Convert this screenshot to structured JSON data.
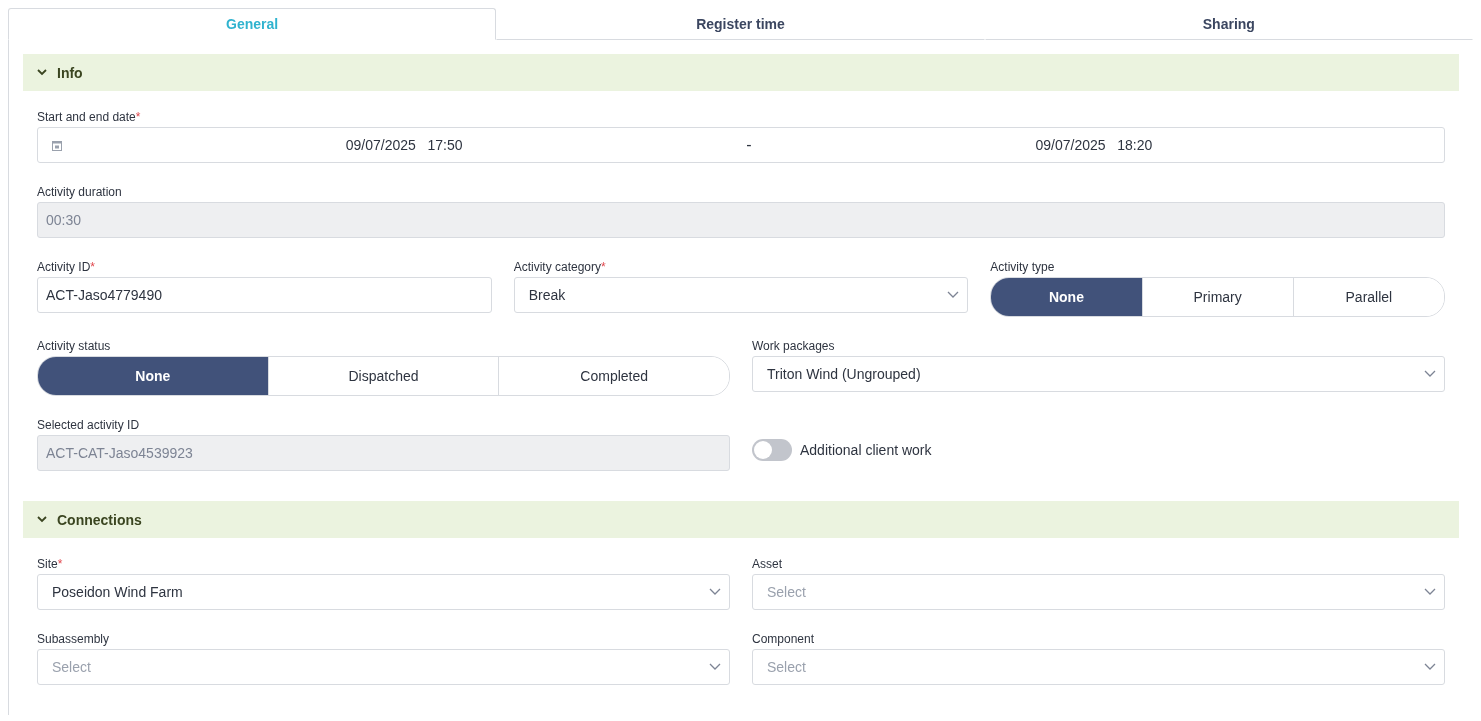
{
  "tabs": [
    {
      "label": "General",
      "selected": true
    },
    {
      "label": "Register time",
      "selected": false
    },
    {
      "label": "Sharing",
      "selected": false
    }
  ],
  "sections": [
    {
      "title": "Info",
      "expanded": true,
      "rows": [
        {
          "fields": [
            {
              "kind": "daterange",
              "label": "Start and end date",
              "marker": "*",
              "start": "09/07/2025   17:50",
              "separator": "-",
              "end": "09/07/2025   18:20"
            }
          ]
        },
        {
          "fields": [
            {
              "kind": "readonly",
              "label": "Activity duration",
              "value": "00:30"
            }
          ]
        },
        {
          "fields": [
            {
              "kind": "text",
              "label": "Activity ID",
              "marker": "*",
              "value": "ACT-Jaso4779490"
            },
            {
              "kind": "select",
              "label": "Activity category",
              "marker": "*",
              "value": "Break"
            },
            {
              "kind": "segmented",
              "label": "Activity type",
              "options": [
                {
                  "label": "None",
                  "selected": true
                },
                {
                  "label": "Primary",
                  "selected": false
                },
                {
                  "label": "Parallel",
                  "selected": false
                }
              ]
            }
          ]
        },
        {
          "fields": [
            {
              "kind": "segmented",
              "label": "Activity status",
              "options": [
                {
                  "label": "None",
                  "selected": true
                },
                {
                  "label": "Dispatched",
                  "selected": false
                },
                {
                  "label": "Completed",
                  "selected": false
                }
              ]
            },
            {
              "kind": "select",
              "label": "Work packages",
              "value": "Triton Wind (Ungrouped)"
            }
          ]
        },
        {
          "fields": [
            {
              "kind": "readonly",
              "label": "Selected activity ID",
              "value": "ACT-CAT-Jaso4539923"
            },
            {
              "kind": "toggle",
              "label": "Additional client work",
              "on": false
            }
          ]
        }
      ]
    },
    {
      "title": "Connections",
      "expanded": true,
      "rows": [
        {
          "fields": [
            {
              "kind": "select",
              "label": "Site",
              "marker": "*",
              "value": "Poseidon Wind Farm"
            },
            {
              "kind": "select",
              "label": "Asset",
              "placeholder": "Select"
            }
          ]
        },
        {
          "fields": [
            {
              "kind": "select",
              "label": "Subassembly",
              "placeholder": "Select"
            },
            {
              "kind": "select",
              "label": "Component",
              "placeholder": "Select"
            }
          ]
        }
      ]
    }
  ]
}
